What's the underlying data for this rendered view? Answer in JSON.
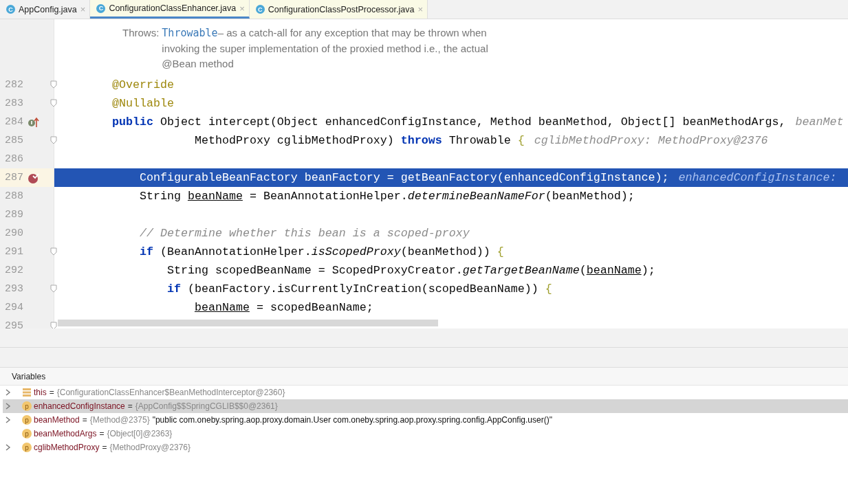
{
  "tabs": [
    {
      "icon": "C",
      "name": "AppConfig.java",
      "close": "×",
      "selected": false,
      "highlighted": false
    },
    {
      "icon": "C",
      "name": "ConfigurationClassEnhancer.java",
      "close": "×",
      "selected": true,
      "highlighted": true
    },
    {
      "icon": "C",
      "name": "ConfigurationClassPostProcessor.java",
      "close": "×",
      "selected": false,
      "highlighted": true
    }
  ],
  "doc": {
    "label": "Throws:",
    "link": "Throwable",
    "lines": [
      "– as a catch-all for any exception that may be thrown when",
      "invoking the super implementation of the proxied method i.e., the actual",
      "@Bean method"
    ]
  },
  "code_lines": [
    {
      "number": "282",
      "fold": true,
      "override": false,
      "breakpoint": false,
      "selected": false,
      "tokens": [
        {
          "kind": "ann",
          "text": "        @Override"
        }
      ]
    },
    {
      "number": "283",
      "fold": true,
      "override": false,
      "breakpoint": false,
      "selected": false,
      "tokens": [
        {
          "kind": "ann",
          "text": "        @Nullable"
        }
      ]
    },
    {
      "number": "284",
      "fold": false,
      "override": true,
      "breakpoint": false,
      "selected": false,
      "tokens": [
        {
          "kind": "kw",
          "text": "        public"
        },
        {
          "kind": "plain",
          "text": " Object intercept(Object enhancedConfigInstance, Method beanMethod, Object[] beanMethodArgs,"
        },
        {
          "kind": "hint",
          "text": "beanMet"
        }
      ]
    },
    {
      "number": "285",
      "fold": true,
      "override": false,
      "breakpoint": false,
      "selected": false,
      "tokens": [
        {
          "kind": "plain",
          "text": "                    MethodProxy cglibMethodProxy) "
        },
        {
          "kind": "kw",
          "text": "throws"
        },
        {
          "kind": "plain",
          "text": " Throwable "
        },
        {
          "kind": "brace",
          "text": "{"
        },
        {
          "kind": "hint",
          "text": "cglibMethodProxy: MethodProxy@2376"
        }
      ]
    },
    {
      "number": "286",
      "fold": false,
      "override": false,
      "breakpoint": false,
      "selected": false
    },
    {
      "number": "287",
      "fold": false,
      "override": false,
      "breakpoint": true,
      "selected": true,
      "tokens": [
        {
          "kind": "plain",
          "text": "            ConfigurableBeanFactory beanFactory = getBeanFactory(enhancedConfigInstance);"
        },
        {
          "kind": "hint",
          "text": "enhancedConfigInstance:"
        }
      ]
    },
    {
      "number": "288",
      "fold": false,
      "override": false,
      "breakpoint": false,
      "selected": false,
      "tokens": [
        {
          "kind": "plain",
          "text": "            String "
        },
        {
          "kind": "under",
          "text": "beanName"
        },
        {
          "kind": "plain",
          "text": " = BeanAnnotationHelper."
        },
        {
          "kind": "italic",
          "text": "determineBeanNameFor"
        },
        {
          "kind": "plain",
          "text": "(beanMethod);"
        }
      ]
    },
    {
      "number": "289",
      "fold": false,
      "override": false,
      "breakpoint": false,
      "selected": false
    },
    {
      "number": "290",
      "fold": false,
      "override": false,
      "breakpoint": false,
      "selected": false,
      "tokens": [
        {
          "kind": "comment",
          "text": "            // Determine whether this bean is a scoped-proxy"
        }
      ]
    },
    {
      "number": "291",
      "fold": true,
      "override": false,
      "breakpoint": false,
      "selected": false,
      "tokens": [
        {
          "kind": "kw",
          "text": "            if"
        },
        {
          "kind": "plain",
          "text": " (BeanAnnotationHelper."
        },
        {
          "kind": "italic",
          "text": "isScopedProxy"
        },
        {
          "kind": "plain",
          "text": "(beanMethod)) "
        },
        {
          "kind": "brace",
          "text": "{"
        }
      ]
    },
    {
      "number": "292",
      "fold": false,
      "override": false,
      "breakpoint": false,
      "selected": false,
      "tokens": [
        {
          "kind": "plain",
          "text": "                String scopedBeanName = ScopedProxyCreator."
        },
        {
          "kind": "italic",
          "text": "getTargetBeanName"
        },
        {
          "kind": "plain",
          "text": "("
        },
        {
          "kind": "under",
          "text": "beanName"
        },
        {
          "kind": "plain",
          "text": ");"
        }
      ]
    },
    {
      "number": "293",
      "fold": true,
      "override": false,
      "breakpoint": false,
      "selected": false,
      "tokens": [
        {
          "kind": "kw",
          "text": "                if"
        },
        {
          "kind": "plain",
          "text": " (beanFactory.isCurrentlyInCreation(scopedBeanName)) "
        },
        {
          "kind": "brace",
          "text": "{"
        }
      ]
    },
    {
      "number": "294",
      "fold": false,
      "override": false,
      "breakpoint": false,
      "selected": false,
      "tokens": [
        {
          "kind": "under",
          "text": "                    beanName"
        },
        {
          "kind": "plain",
          "text": " = scopedBeanName;"
        }
      ]
    },
    {
      "number": "295",
      "fold": true,
      "override": false,
      "breakpoint": false,
      "selected": false
    }
  ],
  "variables_panel": {
    "title": "Variables",
    "rows": [
      {
        "kind": "field",
        "name": "this",
        "eq": "=",
        "value": "{ConfigurationClassEnhancer$BeanMethodInterceptor@2360}",
        "expandable": true,
        "selected": false
      },
      {
        "kind": "param",
        "icon": "p",
        "name": "enhancedConfigInstance",
        "eq": "=",
        "value": "{AppConfig$$SpringCGLIB$$0@2361}",
        "expandable": true,
        "selected": true
      },
      {
        "kind": "param",
        "icon": "p",
        "name": "beanMethod",
        "eq": "=",
        "value": "{Method@2375}",
        "text": "\"public com.oneby.spring.aop.proxy.domain.User com.oneby.spring.aop.proxy.spring.config.AppConfig.user()\"",
        "expandable": true,
        "selected": false
      },
      {
        "kind": "param",
        "icon": "p",
        "name": "beanMethodArgs",
        "eq": "=",
        "value": "{Object[0]@2363}",
        "expandable": false,
        "selected": false
      },
      {
        "kind": "param",
        "icon": "p",
        "name": "cglibMethodProxy",
        "eq": "=",
        "value": "{MethodProxy@2376}",
        "expandable": true,
        "selected": false
      }
    ]
  }
}
